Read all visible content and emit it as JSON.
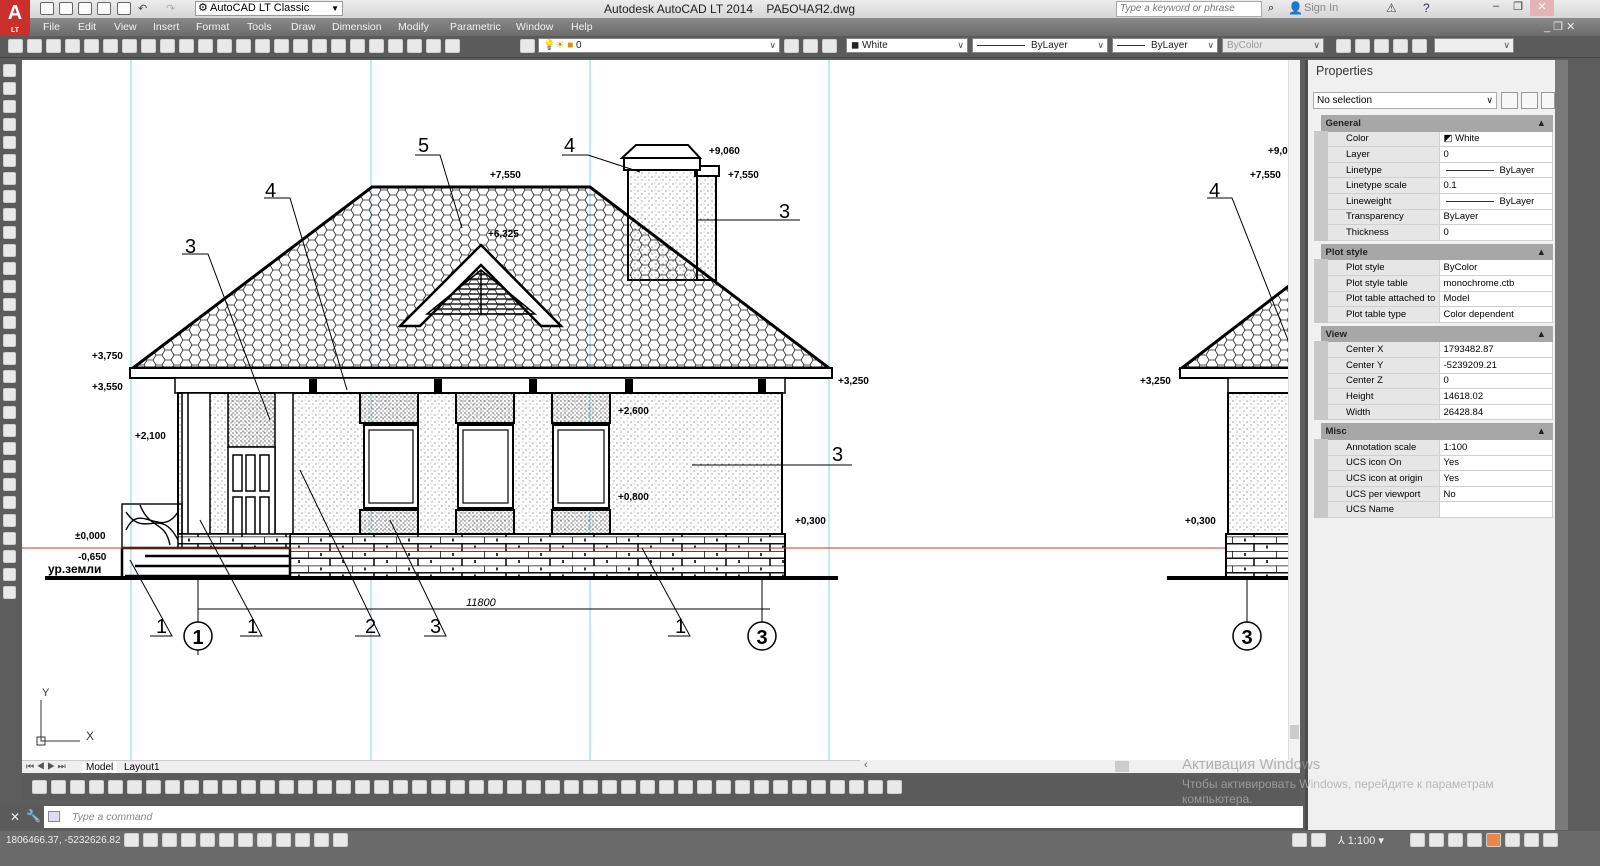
{
  "app": {
    "logo": "A",
    "logo_sub": "LT",
    "title": "Autodesk AutoCAD LT 2014    РАБОЧАЯ2.dwg",
    "workspace": "AutoCAD LT Classic",
    "search_placeholder": "Type a keyword or phrase",
    "sign_in": "Sign In",
    "accent": "#c9302c"
  },
  "menu": [
    "File",
    "Edit",
    "View",
    "Insert",
    "Format",
    "Tools",
    "Draw",
    "Dimension",
    "Modify",
    "Parametric",
    "Window",
    "Help"
  ],
  "toolbar": {
    "layer": "0",
    "color": "White",
    "linetype": "ByLayer",
    "lineweight": "ByLayer",
    "plotstyle": "ByColor"
  },
  "tabs": [
    "Model",
    "Layout1"
  ],
  "command": {
    "placeholder": "Type a command"
  },
  "status": {
    "coords": "1806466.37, -5232626.82",
    "annotation_scale": "1:100"
  },
  "watermark": {
    "title": "Активация Windows",
    "text": "Чтобы активировать Windows, перейдите к параметрам компьютера."
  },
  "properties": {
    "title": "Properties",
    "selection": "No selection",
    "sections": [
      {
        "name": "General",
        "rows": [
          [
            "Color",
            "White"
          ],
          [
            "Layer",
            "0"
          ],
          [
            "Linetype",
            "ByLayer"
          ],
          [
            "Linetype scale",
            "0.1"
          ],
          [
            "Lineweight",
            "ByLayer"
          ],
          [
            "Transparency",
            "ByLayer"
          ],
          [
            "Thickness",
            "0"
          ]
        ]
      },
      {
        "name": "Plot style",
        "rows": [
          [
            "Plot style",
            "ByColor"
          ],
          [
            "Plot style table",
            "monochrome.ctb"
          ],
          [
            "Plot table attached to",
            "Model"
          ],
          [
            "Plot table type",
            "Color dependent"
          ]
        ]
      },
      {
        "name": "View",
        "rows": [
          [
            "Center X",
            "1793482.87"
          ],
          [
            "Center Y",
            "-5239209.21"
          ],
          [
            "Center Z",
            "0"
          ],
          [
            "Height",
            "14618.02"
          ],
          [
            "Width",
            "26428.84"
          ]
        ]
      },
      {
        "name": "Misc",
        "rows": [
          [
            "Annotation scale",
            "1:100"
          ],
          [
            "UCS icon On",
            "Yes"
          ],
          [
            "UCS icon at origin",
            "Yes"
          ],
          [
            "UCS per viewport",
            "No"
          ],
          [
            "UCS Name",
            ""
          ]
        ]
      }
    ]
  },
  "drawing": {
    "levels": [
      "+9,060",
      "+7,550",
      "+7,550",
      "+6,325",
      "+3,750",
      "+3,550",
      "+3,250",
      "+2,100",
      "+2,600",
      "+0,800",
      "+0,300",
      "±0,000",
      "-0,650",
      "ур.земли",
      "+9,0",
      "+7,550",
      "+3,250",
      "+0,300"
    ],
    "leaders": [
      "5",
      "4",
      "4",
      "3",
      "3",
      "3",
      "1",
      "1",
      "2",
      "3",
      "1",
      "4"
    ],
    "axes": [
      "1",
      "3",
      "3"
    ],
    "dimension": "11800",
    "ucs": {
      "x": "X",
      "y": "Y"
    }
  }
}
